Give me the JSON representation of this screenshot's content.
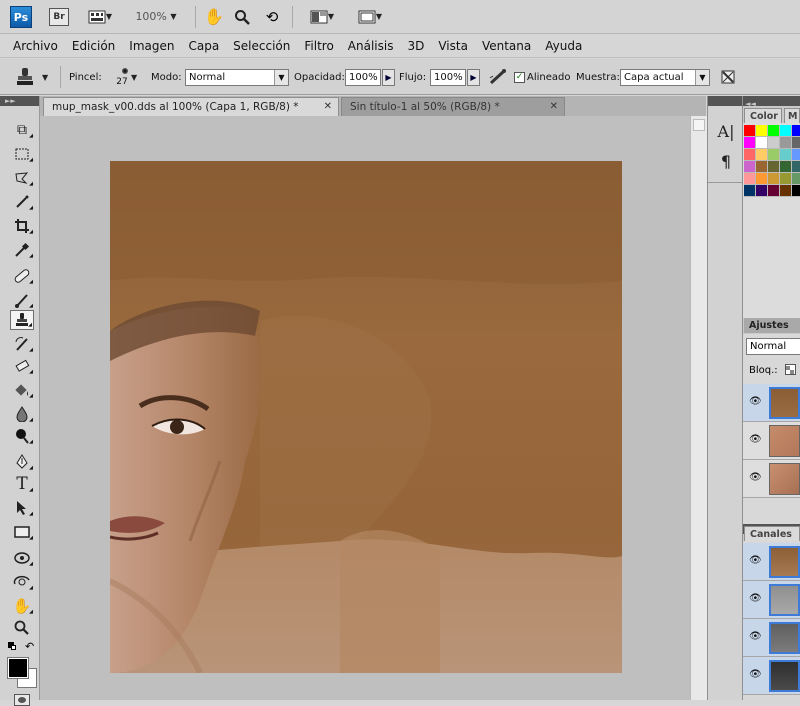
{
  "appbar": {
    "ps_logo": "Ps",
    "br_logo": "Br",
    "zoom": "100%"
  },
  "menu": [
    "Archivo",
    "Edición",
    "Imagen",
    "Capa",
    "Selección",
    "Filtro",
    "Análisis",
    "3D",
    "Vista",
    "Ventana",
    "Ayuda"
  ],
  "options": {
    "brush_label": "Pincel:",
    "brush_size": "27",
    "mode_label": "Modo:",
    "mode_value": "Normal",
    "opacity_label": "Opacidad:",
    "opacity_value": "100%",
    "flow_label": "Flujo:",
    "flow_value": "100%",
    "aligned_label": "Alineado",
    "sample_label": "Muestra:",
    "sample_value": "Capa actual"
  },
  "tabs": [
    {
      "label": "mup_mask_v00.dds al 100% (Capa 1, RGB/8) *",
      "active": true
    },
    {
      "label": "Sin título-1 al 50% (RGB/8) *",
      "active": false
    }
  ],
  "panels": {
    "color_tab": "Color",
    "m_tab": "M",
    "adjust_tab": "Ajustes",
    "blend_mode": "Normal",
    "lock_label": "Bloq.:",
    "channels_tab": "Canales"
  },
  "swatch_colors": [
    "#ff0000",
    "#ffff00",
    "#00ff00",
    "#00ffff",
    "#0000ff",
    "#ff00ff",
    "#ffffff",
    "#cccccc",
    "#999999",
    "#666666",
    "#ff6666",
    "#ffcc66",
    "#99cc66",
    "#66cccc",
    "#6699ff",
    "#cc66cc",
    "#996633",
    "#666633",
    "#336633",
    "#336666",
    "#ff9999",
    "#ff9933",
    "#cc9933",
    "#999933",
    "#669966",
    "#003366",
    "#330066",
    "#660033",
    "#663300",
    "#000000"
  ],
  "accent": "#3d7bd6"
}
